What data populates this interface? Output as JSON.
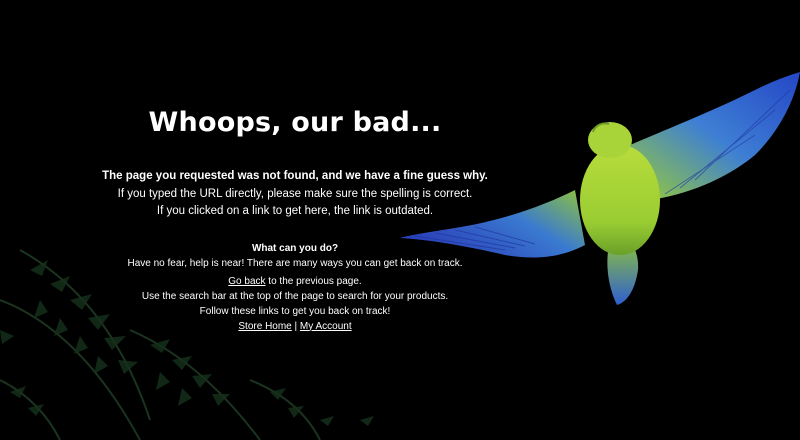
{
  "page": {
    "title": "Whoops, our bad...",
    "intro": {
      "lead": "The page you requested was not found, and we have a fine guess why.",
      "line1": "If you typed the URL directly, please make sure the spelling is correct.",
      "line2": "If you clicked on a link to get here, the link is outdated."
    },
    "help": {
      "heading": "What can you do?",
      "reassure": "Have no fear, help is near! There are many ways you can get back on track.",
      "go_back_link": "Go back",
      "go_back_rest": " to the previous page.",
      "search_hint": "Use the search bar at the top of the page to search for your products.",
      "follow_links": "Follow these links to get you back on track!",
      "store_home_link": "Store Home",
      "separator": " | ",
      "my_account_link": "My Account"
    }
  },
  "colors": {
    "background": "#000000",
    "text": "#ffffff",
    "parrot_body": "#9acd32",
    "parrot_wing": "#2f57d8",
    "fern": "#1a3320"
  },
  "icons": {
    "decor": "parrot-illustration",
    "background": "fern-foliage"
  }
}
